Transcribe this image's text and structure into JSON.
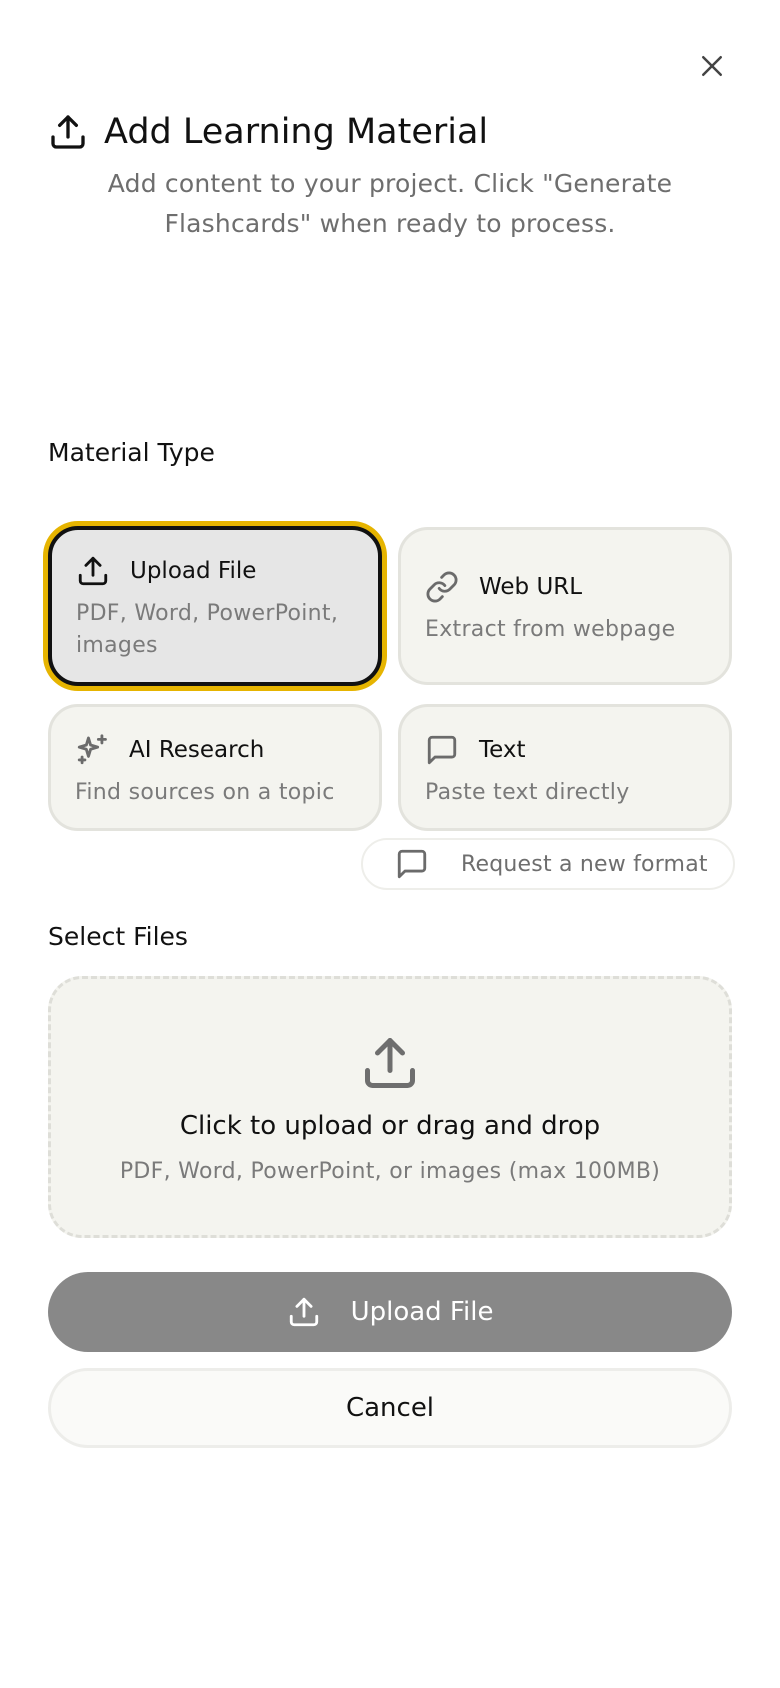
{
  "dialog": {
    "title": "Add Learning Material",
    "subtitle": "Add content to your project. Click \"Generate Flashcards\" when ready to process.",
    "header_icon": "upload-icon",
    "close_icon": "close-icon"
  },
  "material_type": {
    "label": "Material Type",
    "options": [
      {
        "title": "Upload File",
        "description": "PDF, Word, PowerPoint, images",
        "icon": "upload-icon",
        "selected": true
      },
      {
        "title": "Web URL",
        "description": "Extract from webpage",
        "icon": "link-icon",
        "selected": false
      },
      {
        "title": "AI Research",
        "description": "Find sources on a topic",
        "icon": "sparkles-icon",
        "selected": false
      },
      {
        "title": "Text",
        "description": "Paste text directly",
        "icon": "message-square-icon",
        "selected": false
      }
    ],
    "request_format_label": "Request a new format"
  },
  "select_files": {
    "label": "Select Files",
    "dropzone_title": "Click to upload or drag and drop",
    "dropzone_hint": "PDF, Word, PowerPoint, or images (max 100MB)"
  },
  "actions": {
    "upload_label": "Upload File",
    "cancel_label": "Cancel"
  },
  "colors": {
    "selected_ring": "#e6b400",
    "card_background": "#f4f4ef",
    "upload_button": "#888888"
  }
}
